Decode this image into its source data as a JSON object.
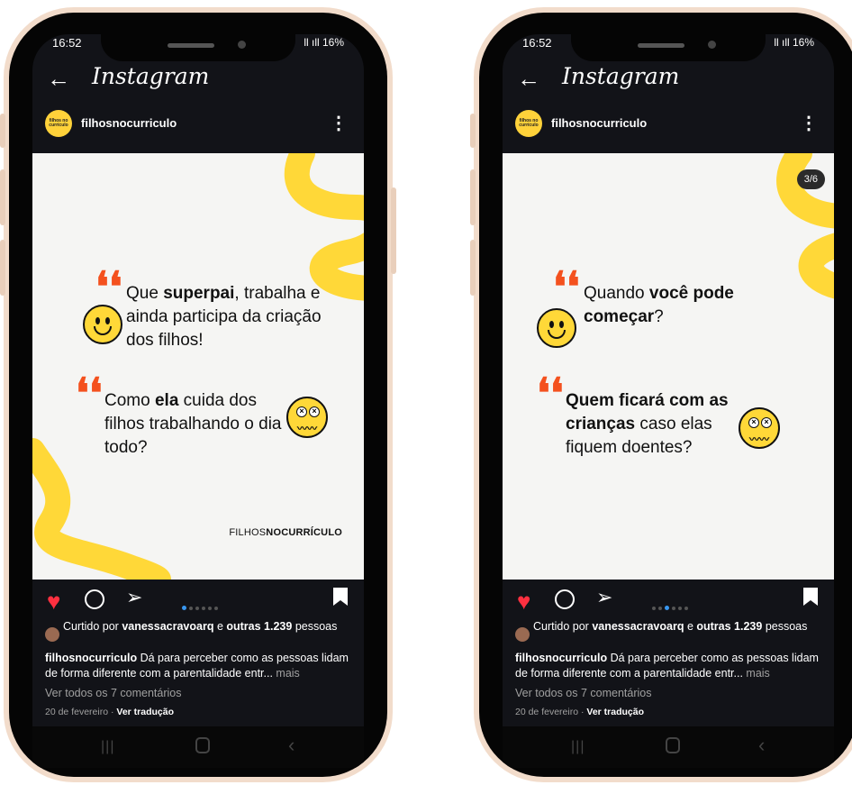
{
  "phones": [
    {
      "status": {
        "time": "16:52",
        "signal": "ll ıll 16%"
      },
      "header": {
        "back": "←",
        "logo": "Instagram"
      },
      "post": {
        "username": "filhosnocurriculo",
        "avatar_text": "filhos no currículo",
        "counter": "",
        "quote1": {
          "pre": "Que ",
          "bold": "superpai",
          "post": ", trabalha e ainda participa da criação dos filhos!"
        },
        "quote2": {
          "pre": "Como ",
          "bold": "ela",
          "post": " cuida dos filhos trabalhando o dia todo?"
        },
        "brand_light": "FILHOS",
        "brand_bold": "NOCURRÍCULO"
      },
      "carousel": {
        "active_index": 0,
        "total": 6
      },
      "likes": {
        "prefix": "Curtido por ",
        "user": "vanessacravoarq",
        "mid": " e ",
        "others": "outras 1.239",
        "suffix": " pessoas"
      },
      "caption": {
        "user": "filhosnocurriculo",
        "text": " Dá para perceber como as pessoas lidam de forma diferente com a parentalidade entr...",
        "more": " mais"
      },
      "comments_link": "Ver todos os 7 comentários",
      "date": "20 de fevereiro",
      "translate": "Ver tradução"
    },
    {
      "status": {
        "time": "16:52",
        "signal": "ll ıll 16%"
      },
      "header": {
        "back": "←",
        "logo": "Instagram"
      },
      "post": {
        "username": "filhosnocurriculo",
        "avatar_text": "filhos no currículo",
        "counter": "3/6",
        "quote1": {
          "pre": "Quando ",
          "bold": "você pode começar",
          "post": "?"
        },
        "quote2": {
          "pre": "",
          "bold": "Quem ficará com as crianças",
          "post": " caso elas fiquem doentes?"
        },
        "brand_light": "",
        "brand_bold": ""
      },
      "carousel": {
        "active_index": 2,
        "total": 6
      },
      "likes": {
        "prefix": "Curtido por ",
        "user": "vanessacravoarq",
        "mid": " e ",
        "others": "outras 1.239",
        "suffix": " pessoas"
      },
      "caption": {
        "user": "filhosnocurriculo",
        "text": " Dá para perceber como as pessoas lidam de forma diferente com a parentalidade entr...",
        "more": " mais"
      },
      "comments_link": "Ver todos os 7 comentários",
      "date": "20 de fevereiro",
      "translate": "Ver tradução"
    }
  ],
  "colors": {
    "accent_yellow": "#ffd838",
    "quote_orange": "#f4511e",
    "like_red": "#ff3040",
    "dot_active": "#3897f0"
  },
  "icons": [
    "heart-icon",
    "comment-icon",
    "share-icon",
    "bookmark-icon",
    "back-arrow-icon",
    "more-options-icon"
  ]
}
